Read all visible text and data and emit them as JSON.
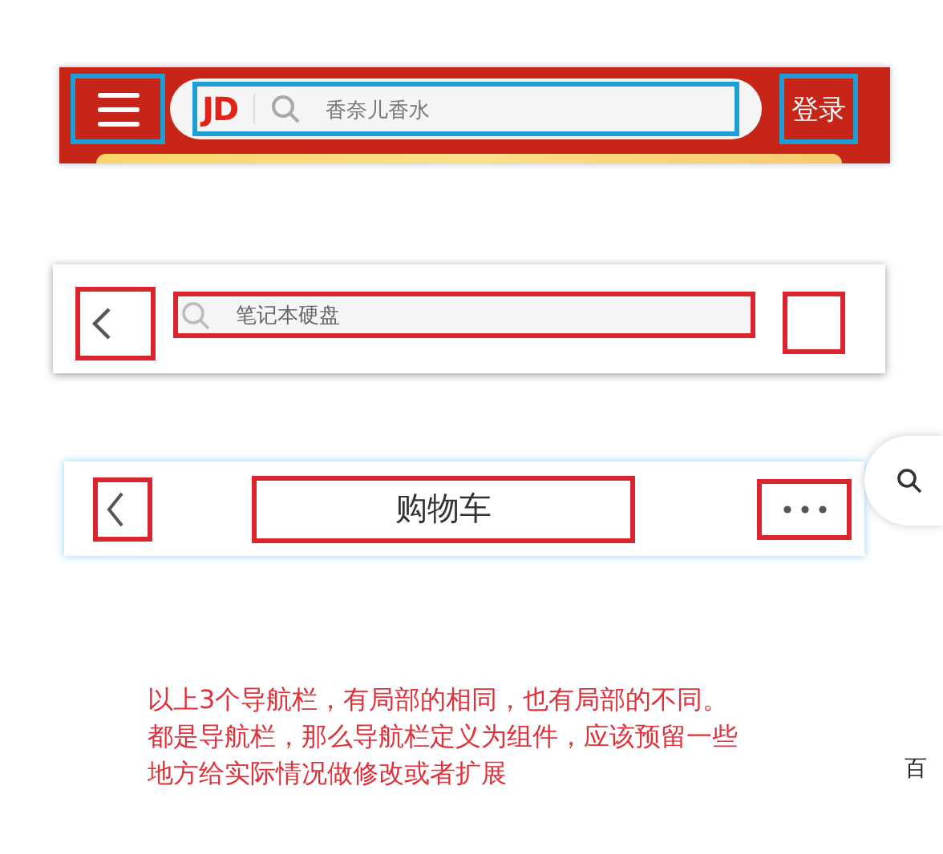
{
  "jd_header": {
    "logo": "JD",
    "search": {
      "placeholder": "香奈儿香水"
    },
    "login_button": "登录"
  },
  "search_header": {
    "search": {
      "placeholder": "笔记本硬盘"
    }
  },
  "title_header": {
    "title": "购物车"
  },
  "note": {
    "lines": [
      "以上3个导航栏，有局部的相同，也有局部的不同。",
      "都是导航栏，那么导航栏定义为组件，应该预留一些",
      "地方给实际情况做修改或者扩展"
    ]
  },
  "side_text": "百"
}
